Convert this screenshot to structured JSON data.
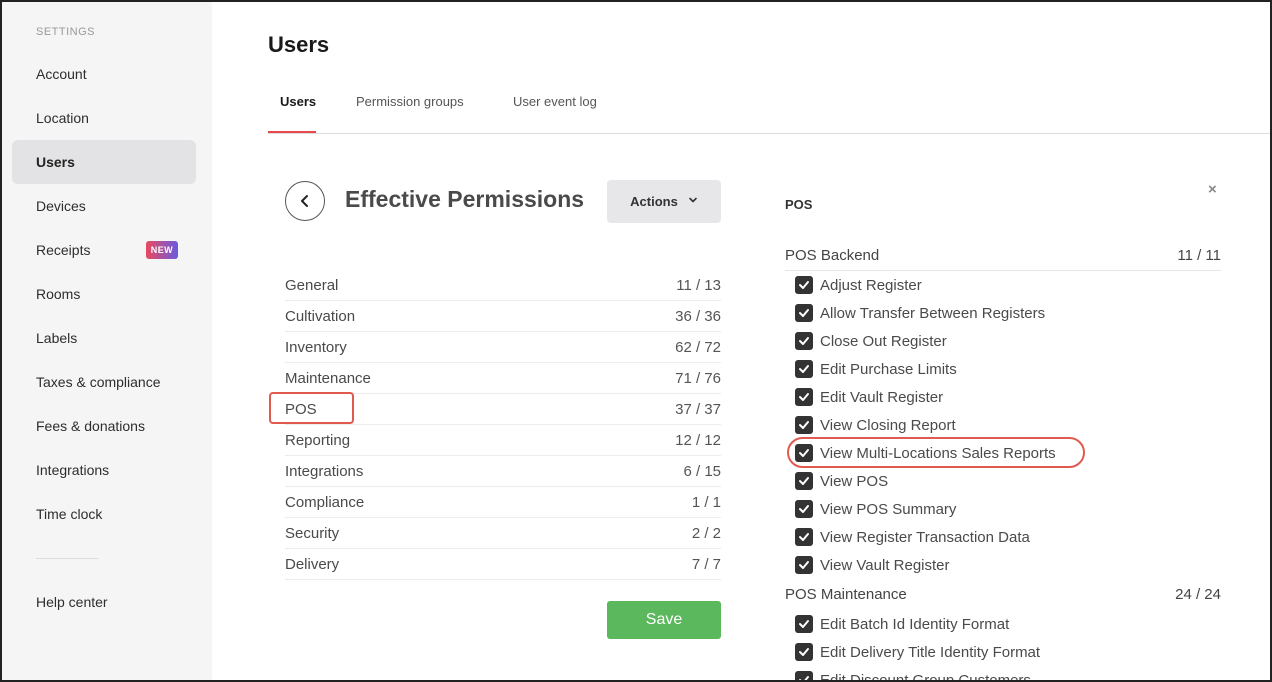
{
  "sidebar": {
    "section_title": "SETTINGS",
    "items": [
      {
        "label": "Account"
      },
      {
        "label": "Location"
      },
      {
        "label": "Users",
        "active": true
      },
      {
        "label": "Devices"
      },
      {
        "label": "Receipts",
        "badge": "NEW"
      },
      {
        "label": "Rooms"
      },
      {
        "label": "Labels"
      },
      {
        "label": "Taxes & compliance"
      },
      {
        "label": "Fees & donations"
      },
      {
        "label": "Integrations"
      },
      {
        "label": "Time clock"
      }
    ],
    "help": "Help center"
  },
  "page": {
    "title": "Users"
  },
  "tabs": [
    {
      "label": "Users",
      "active": true
    },
    {
      "label": "Permission groups"
    },
    {
      "label": "User event log"
    }
  ],
  "panel": {
    "title": "Effective Permissions",
    "actions_label": "Actions",
    "save_label": "Save",
    "categories": [
      {
        "name": "General",
        "count": "11 / 13"
      },
      {
        "name": "Cultivation",
        "count": "36 / 36"
      },
      {
        "name": "Inventory",
        "count": "62 / 72"
      },
      {
        "name": "Maintenance",
        "count": "71 / 76"
      },
      {
        "name": "POS",
        "count": "37 / 37"
      },
      {
        "name": "Reporting",
        "count": "12 / 12"
      },
      {
        "name": "Integrations",
        "count": "6 / 15"
      },
      {
        "name": "Compliance",
        "count": "1 / 1"
      },
      {
        "name": "Security",
        "count": "2 / 2"
      },
      {
        "name": "Delivery",
        "count": "7 / 7"
      }
    ]
  },
  "detail": {
    "heading": "POS",
    "close": "×",
    "groups": [
      {
        "name": "POS Backend",
        "count": "11 / 11",
        "permissions": [
          "Adjust Register",
          "Allow Transfer Between Registers",
          "Close Out Register",
          "Edit Purchase Limits",
          "Edit Vault Register",
          "View Closing Report",
          "View Multi-Locations Sales Reports",
          "View POS",
          "View POS Summary",
          "View Register Transaction Data",
          "View Vault Register"
        ]
      },
      {
        "name": "POS Maintenance",
        "count": "24 / 24",
        "permissions": [
          "Edit Batch Id Identity Format",
          "Edit Delivery Title Identity Format",
          "Edit Discount Group Customers"
        ]
      }
    ]
  }
}
